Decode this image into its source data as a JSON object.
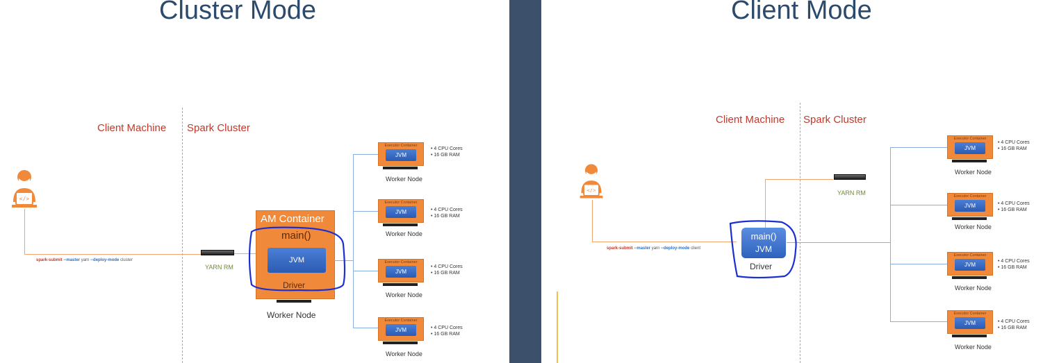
{
  "cluster_mode": {
    "title": "Cluster Mode",
    "client_machine_label": "Client Machine",
    "spark_cluster_label": "Spark Cluster",
    "command": {
      "spark_submit": "spark-submit",
      "master": "--master",
      "master_value": "yarn",
      "deploy_mode": "--deploy-mode",
      "deploy_mode_value": "cluster"
    },
    "yarn_rm_label": "YARN RM",
    "am_container": {
      "title": "AM Container",
      "main": "main()",
      "jvm": "JVM",
      "driver": "Driver"
    },
    "am_worker_node_label": "Worker Node",
    "executors": [
      {
        "container_label": "Executor Container",
        "jvm": "JVM",
        "worker_node": "Worker Node",
        "specs": [
          "• 4 CPU Cores",
          "• 16 GB RAM"
        ]
      },
      {
        "container_label": "Executor Container",
        "jvm": "JVM",
        "worker_node": "Worker Node",
        "specs": [
          "• 4 CPU Cores",
          "• 16 GB RAM"
        ]
      },
      {
        "container_label": "Executor Container",
        "jvm": "JVM",
        "worker_node": "Worker Node",
        "specs": [
          "• 4 CPU Cores",
          "• 16 GB RAM"
        ]
      },
      {
        "container_label": "Executor Container",
        "jvm": "JVM",
        "worker_node": "Worker Node",
        "specs": [
          "• 4 CPU Cores",
          "• 16 GB RAM"
        ]
      }
    ]
  },
  "client_mode": {
    "title": "Client Mode",
    "client_machine_label": "Client Machine",
    "spark_cluster_label": "Spark Cluster",
    "command": {
      "spark_submit": "spark-submit",
      "master": "--master",
      "master_value": "yarn",
      "deploy_mode": "--deploy-mode",
      "deploy_mode_value": "client"
    },
    "yarn_rm_label": "YARN RM",
    "driver": {
      "main": "main()",
      "jvm": "JVM",
      "label": "Driver"
    },
    "executors": [
      {
        "container_label": "Executor Container",
        "jvm": "JVM",
        "worker_node": "Worker Node",
        "specs": [
          "• 4 CPU Cores",
          "• 16 GB RAM"
        ]
      },
      {
        "container_label": "Executor Container",
        "jvm": "JVM",
        "worker_node": "Worker Node",
        "specs": [
          "• 4 CPU Cores",
          "• 16 GB RAM"
        ]
      },
      {
        "container_label": "Executor Container",
        "jvm": "JVM",
        "worker_node": "Worker Node",
        "specs": [
          "• 4 CPU Cores",
          "• 16 GB RAM"
        ]
      },
      {
        "container_label": "Executor Container",
        "jvm": "JVM",
        "worker_node": "Worker Node",
        "specs": [
          "• 4 CPU Cores",
          "• 16 GB RAM"
        ]
      }
    ]
  },
  "colors": {
    "title": "#2c4a6c",
    "zone_label": "#c0392b",
    "container": "#f08a3a",
    "jvm": "#2f62bd",
    "divider": "#3c4f6b",
    "ink": "#1a2fd0",
    "yarn_label": "#6e8a3a"
  },
  "icons": [
    "developer-icon",
    "server-icon"
  ]
}
